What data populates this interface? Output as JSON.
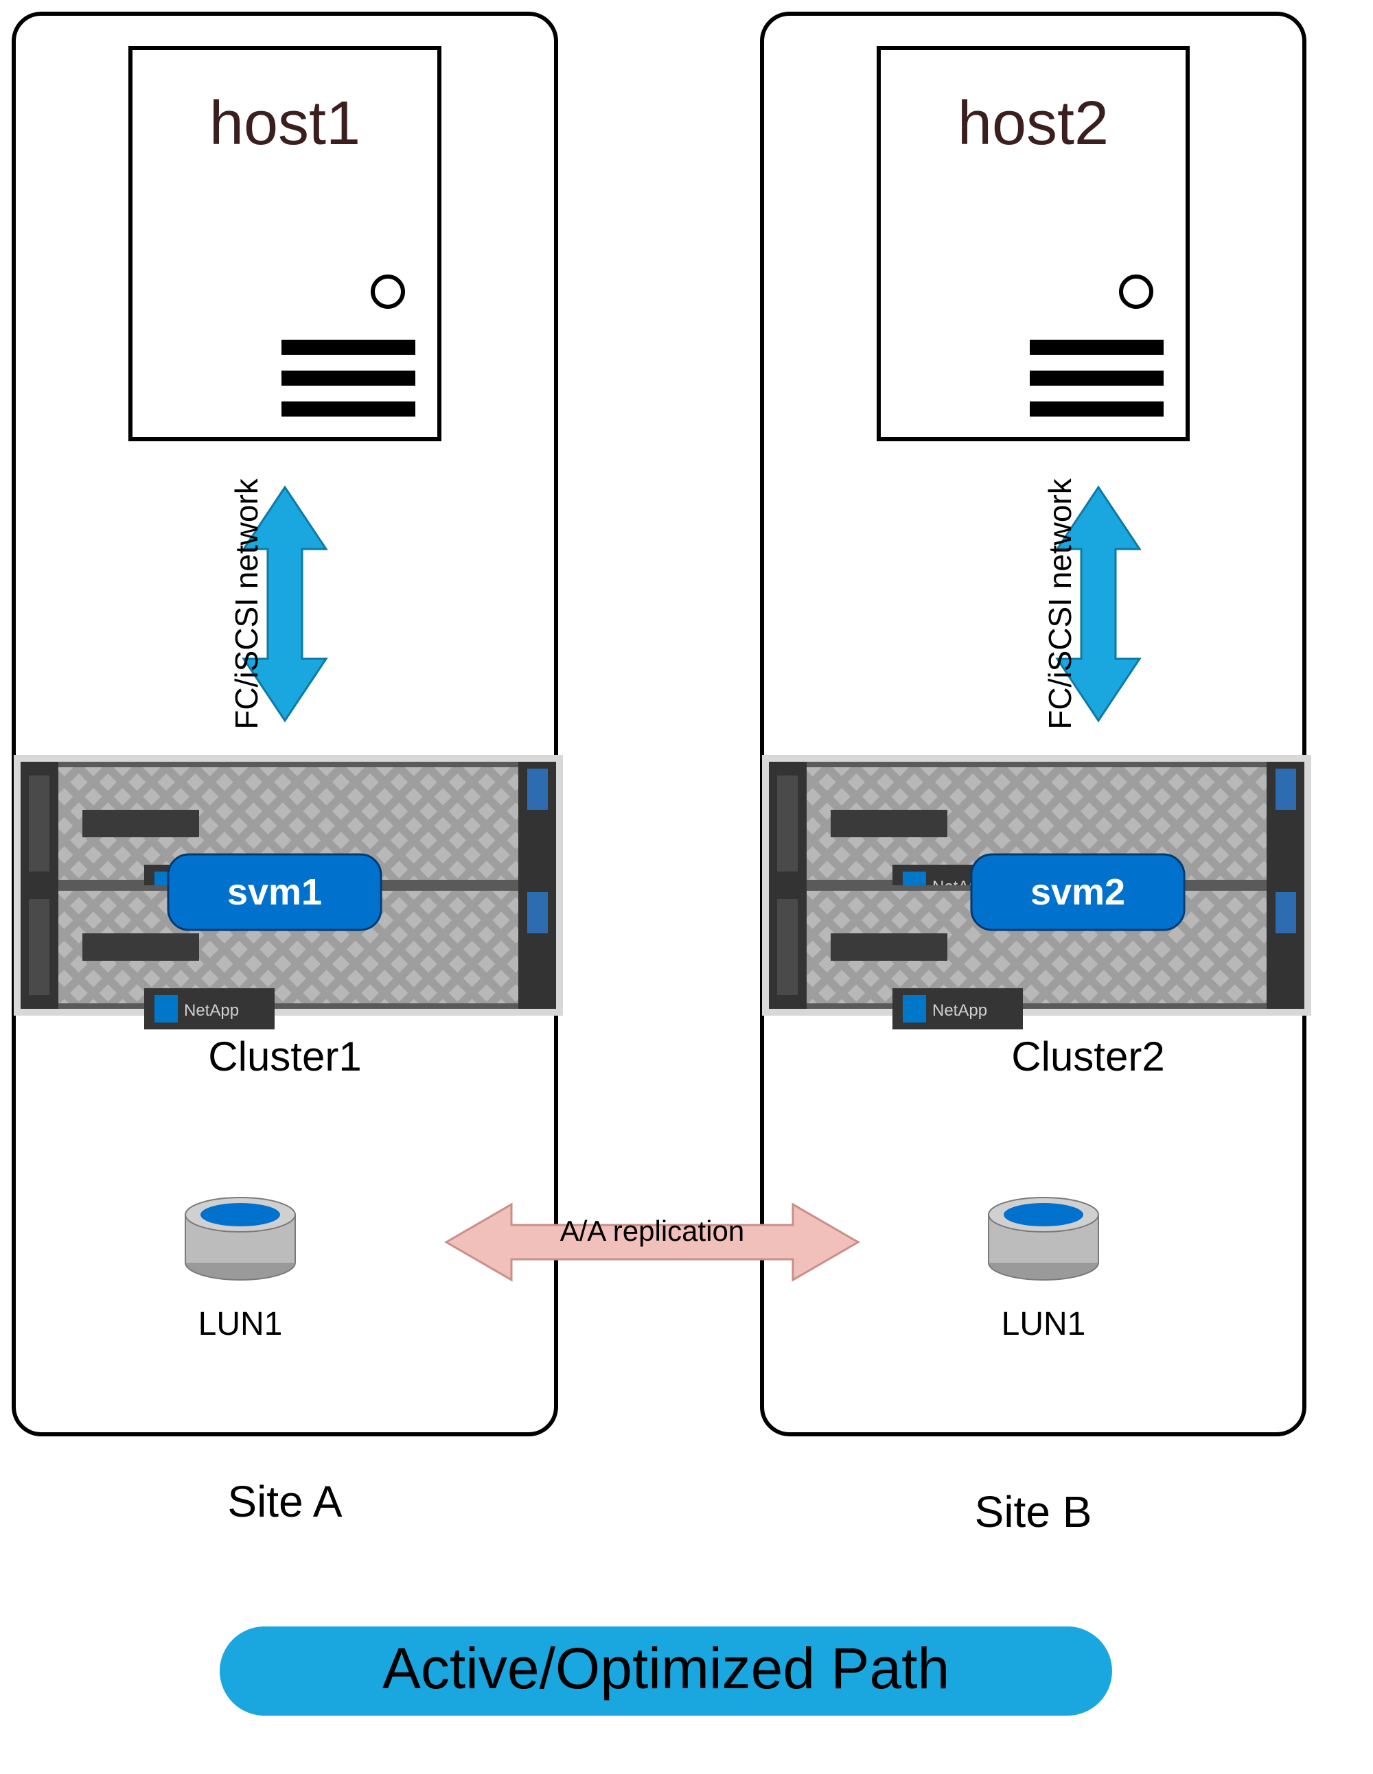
{
  "siteA": {
    "host": "host1",
    "network": "FC/iSCSI network",
    "svm": "svm1",
    "cluster": "Cluster1",
    "lun": "LUN1",
    "label": "Site A"
  },
  "siteB": {
    "host": "host2",
    "network": "FC/iSCSI network",
    "svm": "svm2",
    "cluster": "Cluster2",
    "lun": "LUN1",
    "label": "Site B"
  },
  "replication": "A/A replication",
  "legend": "Active/Optimized Path"
}
